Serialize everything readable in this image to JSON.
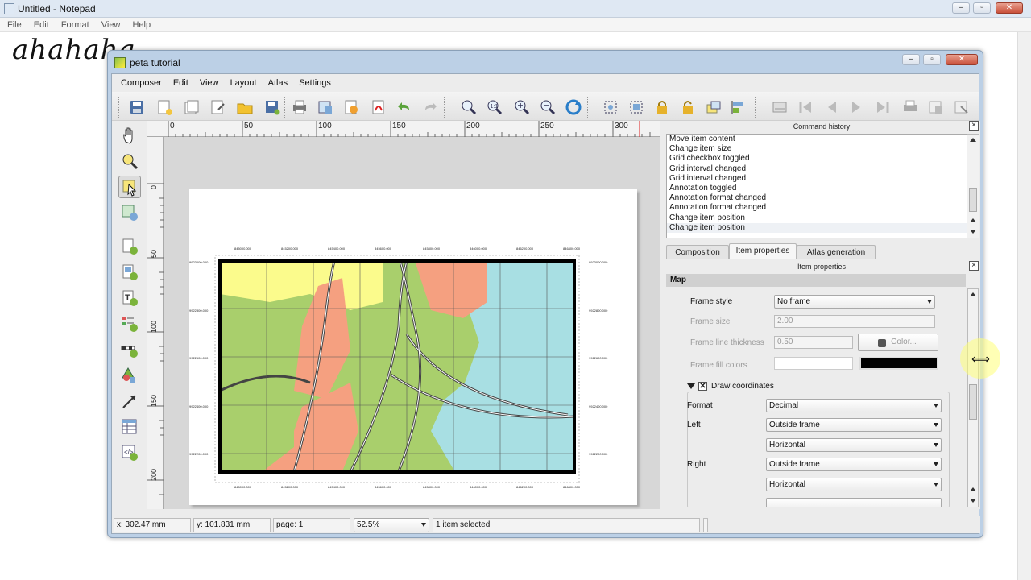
{
  "notepad": {
    "title": "Untitled - Notepad",
    "menu": [
      "File",
      "Edit",
      "Format",
      "View",
      "Help"
    ],
    "text": "ahahaha"
  },
  "window": {
    "title": "peta tutorial",
    "menu": [
      "Composer",
      "Edit",
      "View",
      "Layout",
      "Atlas",
      "Settings"
    ]
  },
  "ruler": {
    "h_ticks": [
      "0",
      "50",
      "100",
      "150",
      "200",
      "250",
      "300"
    ],
    "v_ticks": [
      "0",
      "50",
      "100",
      "150",
      "200"
    ]
  },
  "map": {
    "top_labels": [
      "845000.000",
      "845200.000",
      "845400.000",
      "845600.000",
      "845800.000",
      "846000.000",
      "846200.000",
      "846400.000"
    ],
    "side_labels": [
      "9923000.000",
      "9922800.000",
      "9922600.000",
      "9922400.000",
      "9922200.000"
    ]
  },
  "history": {
    "title": "Command history",
    "items": [
      "Move item content",
      "Change item size",
      "Grid checkbox toggled",
      "Grid interval changed",
      "Grid interval changed",
      "Annotation toggled",
      "Annotation format changed",
      "Annotation format changed",
      "Change item position",
      "Change item position"
    ]
  },
  "tabs": [
    "Composition",
    "Item properties",
    "Atlas generation"
  ],
  "item_props": {
    "title": "Item properties",
    "section": "Map",
    "frame_style_label": "Frame style",
    "frame_style_value": "No frame",
    "frame_size_label": "Frame size",
    "frame_size_value": "2.00",
    "frame_thickness_label": "Frame line thickness",
    "frame_thickness_value": "0.50",
    "color_button": "Color...",
    "fill_label": "Frame fill colors",
    "draw_coords_label": "Draw coordinates",
    "format_label": "Format",
    "format_value": "Decimal",
    "left_label": "Left",
    "left_pos": "Outside frame",
    "left_dir": "Horizontal",
    "right_label": "Right",
    "right_pos": "Outside frame",
    "right_dir": "Horizontal"
  },
  "status": {
    "x": "x: 302.47 mm",
    "y": "y: 101.831 mm",
    "page": "page: 1",
    "zoom": "52.5%",
    "selection": "1 item selected"
  },
  "colors": {
    "water": "#a8dfe3",
    "park": "#a9cf6c",
    "urban": "#f5a080",
    "residential": "#fbfb8c"
  }
}
